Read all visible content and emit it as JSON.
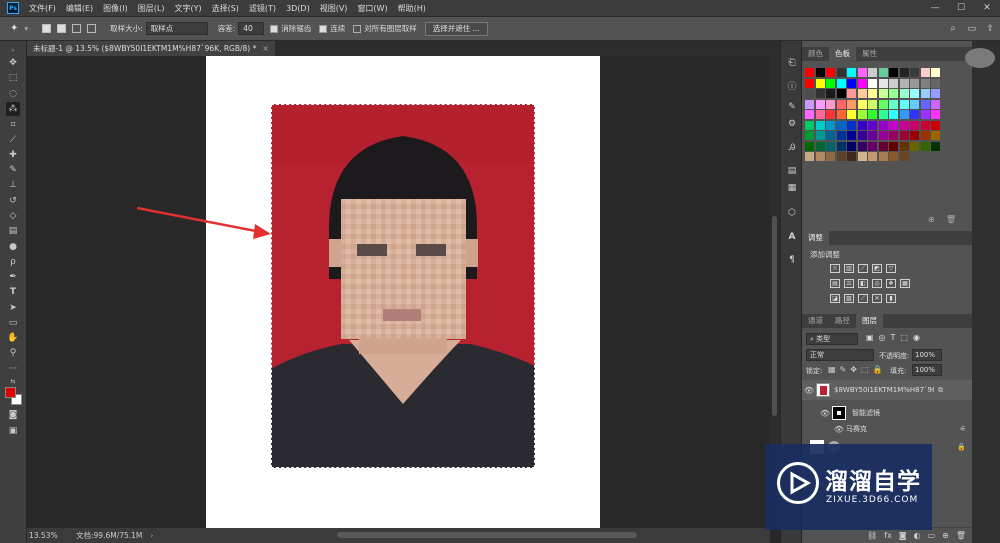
{
  "menu": {
    "app_icon": "Ps",
    "items": [
      "文件(F)",
      "编辑(E)",
      "图像(I)",
      "图层(L)",
      "文字(Y)",
      "选择(S)",
      "滤镜(T)",
      "3D(D)",
      "视图(V)",
      "窗口(W)",
      "帮助(H)"
    ],
    "window_controls": [
      "—",
      "☐",
      "✕"
    ]
  },
  "options": {
    "sample_size_label": "取样大小:",
    "sample_size_value": "取样点",
    "tolerance_label": "容差:",
    "tolerance_value": "40",
    "antialias_label": "消除锯齿",
    "contiguous_label": "连续",
    "all_layers_label": "对所有图层取样",
    "select_mask_label": "选择并遮住 ..."
  },
  "document": {
    "tab_title": "未标题-1 @ 13.5% ($8WBY50I1EKTM1M%H87`96K, RGB/8) *",
    "close": "×"
  },
  "status": {
    "zoom": "13.53%",
    "doc_info": "文档:99.6M/75.1M",
    "arrow": "›"
  },
  "panels": {
    "swatch_tabs": [
      "颜色",
      "色板",
      "属性"
    ],
    "adjust_tab": "调整",
    "adjust_add": "添加调整",
    "layer_tabs": [
      "通道",
      "路径",
      "图层"
    ],
    "filter_kind": "类型",
    "blend_mode": "正常",
    "opacity_label": "不透明度:",
    "opacity_value": "100%",
    "lock_label": "锁定:",
    "fill_label": "填充:",
    "fill_value": "100%",
    "layer_name": "$8WBY50I1EKTM1M%H87`96K",
    "smart_filter": "智能滤镜",
    "mosaic_filter": "马赛克"
  },
  "watermark": {
    "title": "溜溜自学",
    "subtitle": "ZIXUE.3D66.COM"
  },
  "colors": {
    "foreground": "#e00000",
    "background": "#ffffff",
    "photo_red": "#b8212f",
    "watermark_bg": "#1a2d60"
  },
  "icons": {
    "move": "move-icon",
    "marquee": "marquee-icon",
    "lasso": "lasso-icon",
    "magic_wand": "magic-wand-icon",
    "crop": "crop-icon",
    "eyedropper": "eyedropper-icon",
    "healing": "healing-brush-icon",
    "brush": "brush-icon",
    "stamp": "clone-stamp-icon",
    "history": "history-brush-icon",
    "eraser": "eraser-icon",
    "gradient": "gradient-icon",
    "blur": "blur-icon",
    "dodge": "dodge-icon",
    "pen": "pen-icon",
    "type": "type-icon",
    "path_select": "path-selection-icon",
    "shape": "rectangle-icon",
    "hand": "hand-icon",
    "zoom": "zoom-icon"
  }
}
